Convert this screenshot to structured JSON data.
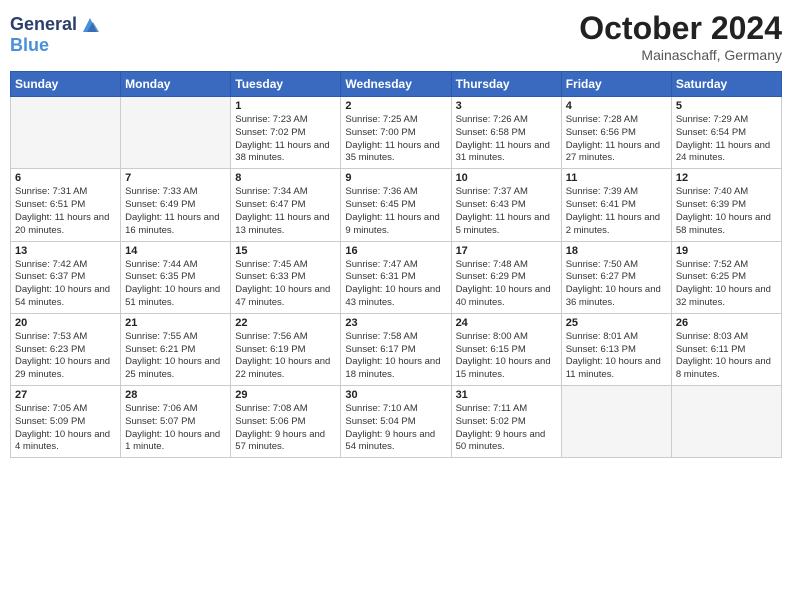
{
  "header": {
    "logo_line1": "General",
    "logo_line2": "Blue",
    "month_year": "October 2024",
    "location": "Mainaschaff, Germany"
  },
  "weekdays": [
    "Sunday",
    "Monday",
    "Tuesday",
    "Wednesday",
    "Thursday",
    "Friday",
    "Saturday"
  ],
  "weeks": [
    [
      {
        "day": "",
        "info": ""
      },
      {
        "day": "",
        "info": ""
      },
      {
        "day": "1",
        "info": "Sunrise: 7:23 AM\nSunset: 7:02 PM\nDaylight: 11 hours and 38 minutes."
      },
      {
        "day": "2",
        "info": "Sunrise: 7:25 AM\nSunset: 7:00 PM\nDaylight: 11 hours and 35 minutes."
      },
      {
        "day": "3",
        "info": "Sunrise: 7:26 AM\nSunset: 6:58 PM\nDaylight: 11 hours and 31 minutes."
      },
      {
        "day": "4",
        "info": "Sunrise: 7:28 AM\nSunset: 6:56 PM\nDaylight: 11 hours and 27 minutes."
      },
      {
        "day": "5",
        "info": "Sunrise: 7:29 AM\nSunset: 6:54 PM\nDaylight: 11 hours and 24 minutes."
      }
    ],
    [
      {
        "day": "6",
        "info": "Sunrise: 7:31 AM\nSunset: 6:51 PM\nDaylight: 11 hours and 20 minutes."
      },
      {
        "day": "7",
        "info": "Sunrise: 7:33 AM\nSunset: 6:49 PM\nDaylight: 11 hours and 16 minutes."
      },
      {
        "day": "8",
        "info": "Sunrise: 7:34 AM\nSunset: 6:47 PM\nDaylight: 11 hours and 13 minutes."
      },
      {
        "day": "9",
        "info": "Sunrise: 7:36 AM\nSunset: 6:45 PM\nDaylight: 11 hours and 9 minutes."
      },
      {
        "day": "10",
        "info": "Sunrise: 7:37 AM\nSunset: 6:43 PM\nDaylight: 11 hours and 5 minutes."
      },
      {
        "day": "11",
        "info": "Sunrise: 7:39 AM\nSunset: 6:41 PM\nDaylight: 11 hours and 2 minutes."
      },
      {
        "day": "12",
        "info": "Sunrise: 7:40 AM\nSunset: 6:39 PM\nDaylight: 10 hours and 58 minutes."
      }
    ],
    [
      {
        "day": "13",
        "info": "Sunrise: 7:42 AM\nSunset: 6:37 PM\nDaylight: 10 hours and 54 minutes."
      },
      {
        "day": "14",
        "info": "Sunrise: 7:44 AM\nSunset: 6:35 PM\nDaylight: 10 hours and 51 minutes."
      },
      {
        "day": "15",
        "info": "Sunrise: 7:45 AM\nSunset: 6:33 PM\nDaylight: 10 hours and 47 minutes."
      },
      {
        "day": "16",
        "info": "Sunrise: 7:47 AM\nSunset: 6:31 PM\nDaylight: 10 hours and 43 minutes."
      },
      {
        "day": "17",
        "info": "Sunrise: 7:48 AM\nSunset: 6:29 PM\nDaylight: 10 hours and 40 minutes."
      },
      {
        "day": "18",
        "info": "Sunrise: 7:50 AM\nSunset: 6:27 PM\nDaylight: 10 hours and 36 minutes."
      },
      {
        "day": "19",
        "info": "Sunrise: 7:52 AM\nSunset: 6:25 PM\nDaylight: 10 hours and 32 minutes."
      }
    ],
    [
      {
        "day": "20",
        "info": "Sunrise: 7:53 AM\nSunset: 6:23 PM\nDaylight: 10 hours and 29 minutes."
      },
      {
        "day": "21",
        "info": "Sunrise: 7:55 AM\nSunset: 6:21 PM\nDaylight: 10 hours and 25 minutes."
      },
      {
        "day": "22",
        "info": "Sunrise: 7:56 AM\nSunset: 6:19 PM\nDaylight: 10 hours and 22 minutes."
      },
      {
        "day": "23",
        "info": "Sunrise: 7:58 AM\nSunset: 6:17 PM\nDaylight: 10 hours and 18 minutes."
      },
      {
        "day": "24",
        "info": "Sunrise: 8:00 AM\nSunset: 6:15 PM\nDaylight: 10 hours and 15 minutes."
      },
      {
        "day": "25",
        "info": "Sunrise: 8:01 AM\nSunset: 6:13 PM\nDaylight: 10 hours and 11 minutes."
      },
      {
        "day": "26",
        "info": "Sunrise: 8:03 AM\nSunset: 6:11 PM\nDaylight: 10 hours and 8 minutes."
      }
    ],
    [
      {
        "day": "27",
        "info": "Sunrise: 7:05 AM\nSunset: 5:09 PM\nDaylight: 10 hours and 4 minutes."
      },
      {
        "day": "28",
        "info": "Sunrise: 7:06 AM\nSunset: 5:07 PM\nDaylight: 10 hours and 1 minute."
      },
      {
        "day": "29",
        "info": "Sunrise: 7:08 AM\nSunset: 5:06 PM\nDaylight: 9 hours and 57 minutes."
      },
      {
        "day": "30",
        "info": "Sunrise: 7:10 AM\nSunset: 5:04 PM\nDaylight: 9 hours and 54 minutes."
      },
      {
        "day": "31",
        "info": "Sunrise: 7:11 AM\nSunset: 5:02 PM\nDaylight: 9 hours and 50 minutes."
      },
      {
        "day": "",
        "info": ""
      },
      {
        "day": "",
        "info": ""
      }
    ]
  ]
}
